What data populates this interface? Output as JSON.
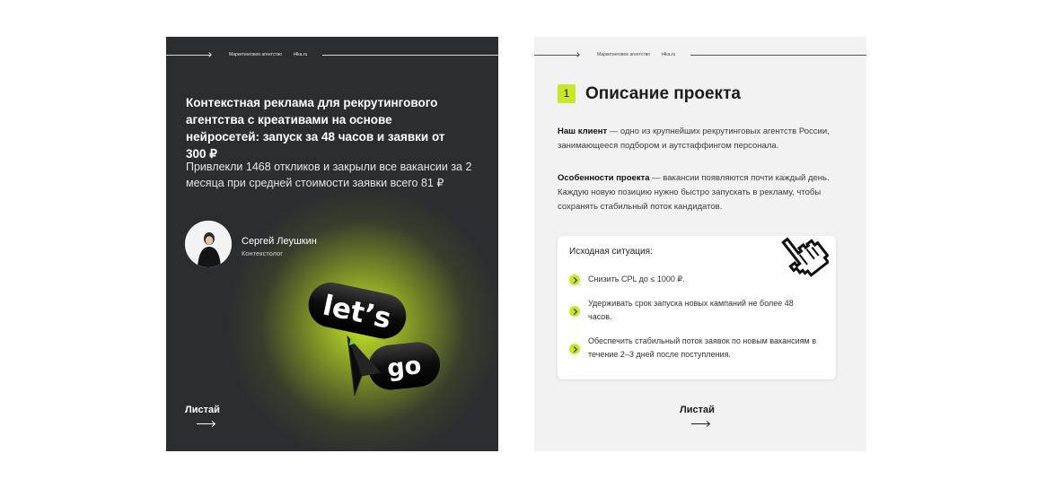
{
  "colors": {
    "dark_bg": "#2b2e30",
    "light_bg": "#f2f2f2",
    "accent": "#c8e62a"
  },
  "header": {
    "agency": "Маркетинговое агентство",
    "site": "t4ka.ru"
  },
  "slide1": {
    "title": "Контекстная реклама для рекрутингового агентства с креативами на основе нейросетей: запуск за 48 часов и заявки от 300 ₽",
    "subtitle": "Привлекли 1468 откликов и закрыли все вакансии за 2 месяца при средней стоимости заявки всего 81 ₽",
    "author_name": "Сергей Леушкин",
    "author_role": "Контекстолог",
    "pill1": "let’s",
    "pill2": "go",
    "swipe": "Листай"
  },
  "slide2": {
    "number": "1",
    "title": "Описание проекта",
    "client_label": "Наш клиент",
    "client_text": " — одно из крупнейших рекрутинговых агентств России, занимающееся подбором и аутстаффингом персонала.",
    "features_label": "Особенности проекта",
    "features_text": " — вакансии появляются почти каждый день. Каждую новую позицию нужно быстро запускать в рекламу, чтобы сохранять стабильный поток кандидатов.",
    "card_title": "Исходная ситуация:",
    "items": [
      "Снизить CPL до ≤ 1000 ₽.",
      " Удерживать срок запуска новых кампаний не более 48 часов.",
      "Обеспечить стабильный поток заявок по новым вакансиям в течение 2–3 дней после поступления."
    ],
    "swipe": "Листай"
  }
}
